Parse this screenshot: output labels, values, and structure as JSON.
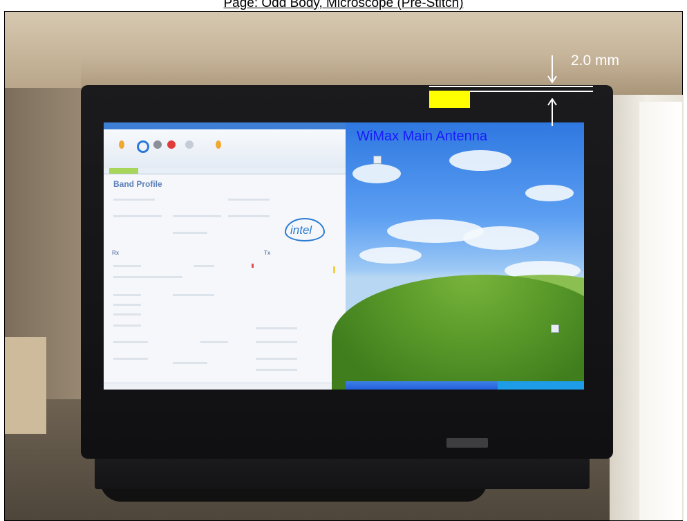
{
  "page_title": "Page: Odd Body, Microscope (Pre-Stitch)",
  "annotations": {
    "dimension_label": "2.0 mm",
    "antenna_label": "WiMax Main Antenna"
  },
  "app_window": {
    "heading": "Band Profile",
    "logo_text": "intel",
    "rx_label": "Rx",
    "tx_label": "Tx"
  },
  "colors": {
    "antenna_highlight": "#ffff00",
    "antenna_label": "#1a1aff",
    "marker_lines": "#ffffff"
  }
}
